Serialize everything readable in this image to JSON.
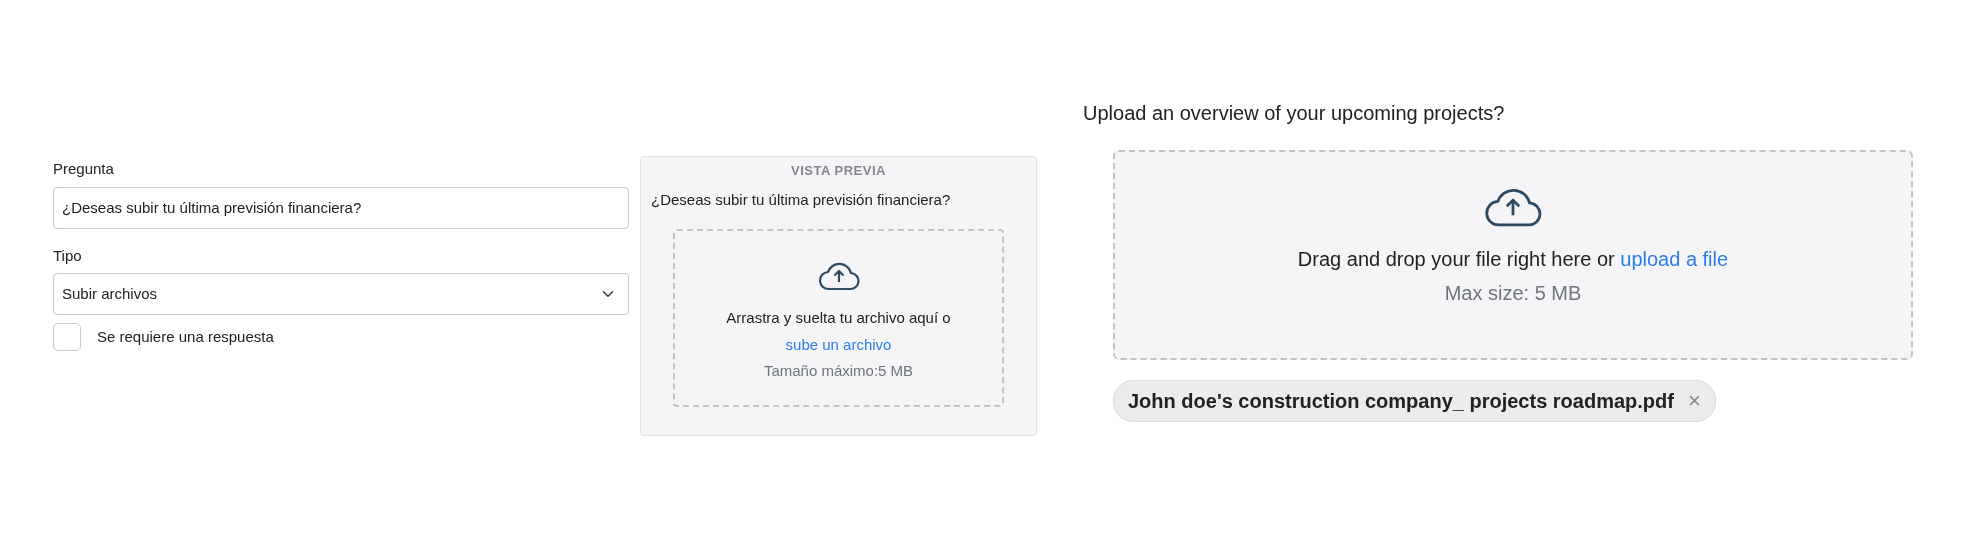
{
  "editor": {
    "question_label": "Pregunta",
    "question_value": "¿Deseas subir tu última previsión financiera?",
    "type_label": "Tipo",
    "type_value": "Subir archivos",
    "required": {
      "label": "Se requiere una respuesta",
      "checked": false
    }
  },
  "preview": {
    "heading": "VISTA PREVIA",
    "question": "¿Deseas subir tu última previsión financiera?",
    "dropzone": {
      "text": "Arrastra y suelta tu archivo aquí o",
      "link": "sube un archivo",
      "max_size": "Tamaño máximo:5 MB"
    }
  },
  "live": {
    "question": "Upload an overview of your upcoming projects?",
    "dropzone": {
      "text": "Drag and drop your file right here or",
      "link": "upload a file",
      "max_size": "Max size: 5 MB"
    },
    "files": [
      {
        "name": "John doe's construction company_ projects roadmap.pdf",
        "remove": "×"
      }
    ]
  }
}
